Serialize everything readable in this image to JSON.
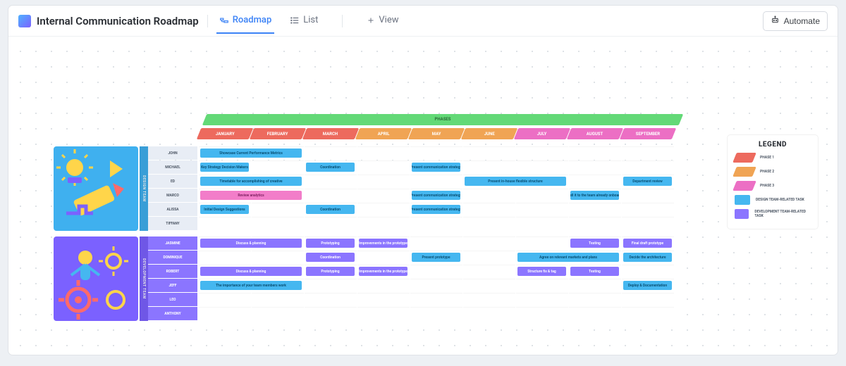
{
  "header": {
    "title": "Internal Communication Roadmap",
    "tabs": [
      {
        "label": "Roadmap",
        "active": true
      },
      {
        "label": "List",
        "active": false
      },
      {
        "label": "View",
        "active": false
      }
    ],
    "automate_label": "Automate"
  },
  "phases_label": "PHASES",
  "months": [
    {
      "label": "JANUARY",
      "color": "m-red"
    },
    {
      "label": "FEBRUARY",
      "color": "m-red"
    },
    {
      "label": "MARCH",
      "color": "m-red"
    },
    {
      "label": "APRIL",
      "color": "m-orange"
    },
    {
      "label": "MAY",
      "color": "m-orange"
    },
    {
      "label": "JUNE",
      "color": "m-orange"
    },
    {
      "label": "JULY",
      "color": "m-pink"
    },
    {
      "label": "AUGUST",
      "color": "m-pink"
    },
    {
      "label": "SEPTEMBER",
      "color": "m-pink"
    }
  ],
  "teams": [
    {
      "side_label": "DESIGN TEAM"
    },
    {
      "side_label": "DEVELOPMENT TEAM"
    }
  ],
  "persons1": [
    "JOHN",
    "MICHAEL",
    "ED",
    "MARCO",
    "ALISSA",
    "TIFFANY"
  ],
  "persons2": [
    "JASMINE",
    "DOMINIQUE",
    "ROBERT",
    "JEFF",
    "LEO",
    "ANTHONY"
  ],
  "tasks1": [
    {
      "row": 0,
      "col": 0,
      "span": 2,
      "label": "Showcase Current Performance Metrics",
      "color": "c-blue"
    },
    {
      "row": 1,
      "col": 0,
      "span": 1,
      "label": "Key Strategy Decision Makers",
      "color": "c-blue"
    },
    {
      "row": 1,
      "col": 2,
      "span": 1,
      "label": "Coordination",
      "color": "c-blue"
    },
    {
      "row": 1,
      "col": 4,
      "span": 1,
      "label": "Present communication strategy",
      "color": "c-blue"
    },
    {
      "row": 2,
      "col": 0,
      "span": 2,
      "label": "Timetable for accomplishing of creative",
      "color": "c-blue"
    },
    {
      "row": 2,
      "col": 5,
      "span": 2,
      "label": "Present in-house flexible structure",
      "color": "c-blue"
    },
    {
      "row": 2,
      "col": 8,
      "span": 1,
      "label": "Department review",
      "color": "c-blue"
    },
    {
      "row": 3,
      "col": 0,
      "span": 2,
      "label": "Review analytics",
      "color": "c-pink"
    },
    {
      "row": 3,
      "col": 4,
      "span": 1,
      "label": "Present communication strategy",
      "color": "c-blue"
    },
    {
      "row": 3,
      "col": 7,
      "span": 1,
      "label": "Sell it to the team already onboard",
      "color": "c-blue"
    },
    {
      "row": 4,
      "col": 0,
      "span": 1,
      "label": "Initial Design Suggestions",
      "color": "c-blue"
    },
    {
      "row": 4,
      "col": 2,
      "span": 1,
      "label": "Coordination",
      "color": "c-blue"
    },
    {
      "row": 4,
      "col": 4,
      "span": 1,
      "label": "Present communication strategy",
      "color": "c-blue"
    }
  ],
  "tasks2": [
    {
      "row": 0,
      "col": 0,
      "span": 2,
      "label": "Discuss & planning",
      "color": "c-purple"
    },
    {
      "row": 0,
      "col": 2,
      "span": 1,
      "label": "Prototyping",
      "color": "c-purple"
    },
    {
      "row": 0,
      "col": 3,
      "span": 1,
      "label": "Improvements in the prototype",
      "color": "c-purple"
    },
    {
      "row": 0,
      "col": 7,
      "span": 1,
      "label": "Testing",
      "color": "c-purple"
    },
    {
      "row": 0,
      "col": 8,
      "span": 1,
      "label": "Final draft prototype",
      "color": "c-purple"
    },
    {
      "row": 1,
      "col": 2,
      "span": 1,
      "label": "Coordination",
      "color": "c-purple"
    },
    {
      "row": 1,
      "col": 4,
      "span": 1,
      "label": "Present prototype",
      "color": "c-blue"
    },
    {
      "row": 1,
      "col": 6,
      "span": 2,
      "label": "Agree on relevant markets and plans",
      "color": "c-blue"
    },
    {
      "row": 1,
      "col": 8,
      "span": 1,
      "label": "Decide the architecture",
      "color": "c-blue"
    },
    {
      "row": 2,
      "col": 0,
      "span": 2,
      "label": "Discuss & planning",
      "color": "c-purple"
    },
    {
      "row": 2,
      "col": 2,
      "span": 1,
      "label": "Prototyping",
      "color": "c-purple"
    },
    {
      "row": 2,
      "col": 3,
      "span": 1,
      "label": "Improvements in the prototype",
      "color": "c-purple"
    },
    {
      "row": 2,
      "col": 6,
      "span": 1,
      "label": "Structure fix & tag",
      "color": "c-purple"
    },
    {
      "row": 2,
      "col": 7,
      "span": 1,
      "label": "Testing",
      "color": "c-purple"
    },
    {
      "row": 3,
      "col": 0,
      "span": 2,
      "label": "The importance of your team members work",
      "color": "c-blue"
    },
    {
      "row": 3,
      "col": 8,
      "span": 1,
      "label": "Deploy & Documentation",
      "color": "c-blue"
    }
  ],
  "legend": {
    "title": "LEGEND",
    "items": [
      {
        "label": "PHASE 1",
        "bg": "#ed6a5e",
        "skew": true
      },
      {
        "label": "PHASE 2",
        "bg": "#f0a454",
        "skew": true
      },
      {
        "label": "PHASE 3",
        "bg": "#ec6fc4",
        "skew": true
      },
      {
        "label": "DESIGN TEAM-RELATED TASK",
        "bg": "#45b7f0",
        "skew": false
      },
      {
        "label": "DEVELOPMENT TEAM-RELATED TASK",
        "bg": "#8b75ff",
        "skew": false
      }
    ]
  }
}
